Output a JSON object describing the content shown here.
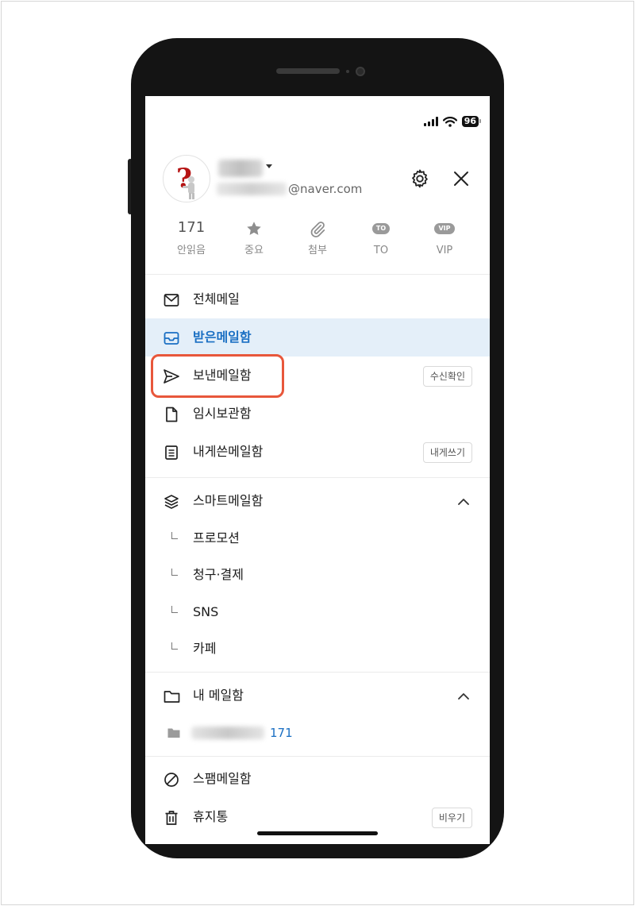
{
  "status_bar": {
    "battery": "96"
  },
  "account": {
    "email_domain": "@naver.com"
  },
  "quick_filters": [
    {
      "value": "171",
      "label": "안읽음",
      "icon": "count"
    },
    {
      "label": "중요",
      "icon": "star-icon"
    },
    {
      "label": "첨부",
      "icon": "paperclip-icon"
    },
    {
      "badge": "TO",
      "label": "TO",
      "icon": "to-badge-icon"
    },
    {
      "badge": "VIP",
      "label": "VIP",
      "icon": "vip-badge-icon"
    }
  ],
  "menu": {
    "all_mail": "전체메일",
    "inbox": "받은메일함",
    "sent": "보낸메일함",
    "sent_action": "수신확인",
    "drafts": "임시보관함",
    "self_mail": "내게쓴메일함",
    "self_action": "내게쓰기"
  },
  "smart_mailbox": {
    "title": "스마트메일함",
    "items": [
      "프로모션",
      "청구·결제",
      "SNS",
      "카페"
    ]
  },
  "my_mailbox": {
    "title": "내 메일함",
    "folder_count": "171"
  },
  "bottom": {
    "spam": "스팸메일함",
    "trash": "휴지통",
    "trash_action": "비우기"
  },
  "colors": {
    "accent": "#1a6fc3",
    "selected_bg": "#e4eff9",
    "highlight": "#e8573b"
  }
}
